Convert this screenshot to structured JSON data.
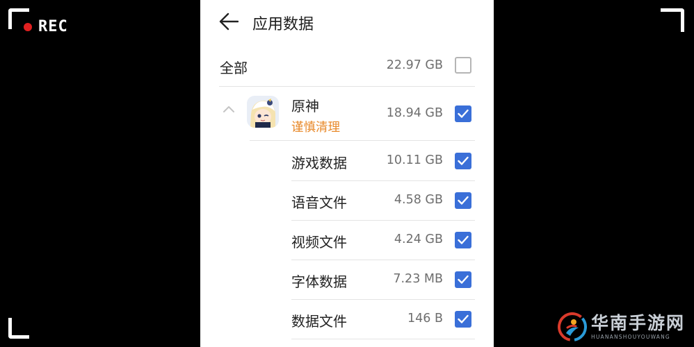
{
  "recording": {
    "label": "REC"
  },
  "header": {
    "title": "应用数据",
    "back_icon": "back-arrow-icon"
  },
  "total": {
    "label": "全部",
    "size": "22.97 GB",
    "checked": false
  },
  "app": {
    "name": "原神",
    "subtitle": "谨慎清理",
    "size": "18.94 GB",
    "checked": true,
    "expanded": true,
    "accent_color": "#e8892a"
  },
  "items": [
    {
      "label": "游戏数据",
      "size": "10.11 GB",
      "checked": true
    },
    {
      "label": "语音文件",
      "size": "4.58 GB",
      "checked": true
    },
    {
      "label": "视频文件",
      "size": "4.24 GB",
      "checked": true
    },
    {
      "label": "字体数据",
      "size": "7.23 MB",
      "checked": true
    },
    {
      "label": "数据文件",
      "size": "146 B",
      "checked": true
    }
  ],
  "checkbox_color": "#3a6fd8",
  "watermark": {
    "title": "华南手游网",
    "subtitle": "HUANANSHOUYOUWANG"
  }
}
